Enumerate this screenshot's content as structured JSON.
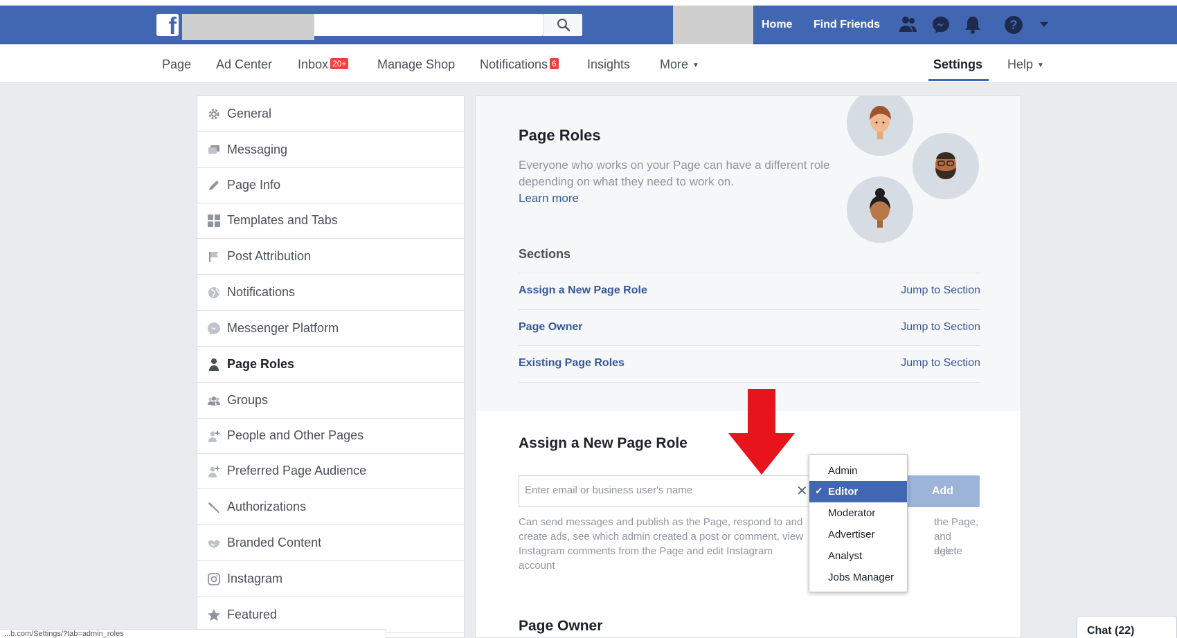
{
  "topbar": {
    "logo": "f",
    "search_placeholder": "",
    "links": {
      "home": "Home",
      "find_friends": "Find Friends"
    },
    "icons": [
      "friend-requests-icon",
      "messenger-icon",
      "notifications-bell-icon",
      "help-icon",
      "account-menu-caret-icon"
    ]
  },
  "page_nav": {
    "items": [
      {
        "label": "Page"
      },
      {
        "label": "Ad Center"
      },
      {
        "label": "Inbox",
        "badge": "20+"
      },
      {
        "label": "Manage Shop"
      },
      {
        "label": "Notifications",
        "badge": "6"
      },
      {
        "label": "Insights"
      },
      {
        "label": "More"
      },
      {
        "label": "Settings",
        "active": true
      },
      {
        "label": "Help"
      }
    ]
  },
  "sidebar": {
    "items": [
      {
        "label": "General",
        "icon": "gear-icon"
      },
      {
        "label": "Messaging",
        "icon": "messaging-icon"
      },
      {
        "label": "Page Info",
        "icon": "pencil-icon"
      },
      {
        "label": "Templates and Tabs",
        "icon": "grid-icon"
      },
      {
        "label": "Post Attribution",
        "icon": "flag-icon"
      },
      {
        "label": "Notifications",
        "icon": "globe-icon"
      },
      {
        "label": "Messenger Platform",
        "icon": "messenger-icon"
      },
      {
        "label": "Page Roles",
        "icon": "person-icon",
        "active": true
      },
      {
        "label": "Groups",
        "icon": "group-icon"
      },
      {
        "label": "People and Other Pages",
        "icon": "person-plus-icon"
      },
      {
        "label": "Preferred Page Audience",
        "icon": "person-plus-icon"
      },
      {
        "label": "Authorizations",
        "icon": "wrench-icon"
      },
      {
        "label": "Branded Content",
        "icon": "handshake-icon"
      },
      {
        "label": "Instagram",
        "icon": "instagram-icon"
      },
      {
        "label": "Featured",
        "icon": "star-icon"
      }
    ]
  },
  "main": {
    "title": "Page Roles",
    "description": "Everyone who works on your Page can have a different role depending on what they need to work on.",
    "learn_more": "Learn more",
    "sections_title": "Sections",
    "sections": [
      {
        "label": "Assign a New Page Role",
        "jump": "Jump to Section"
      },
      {
        "label": "Page Owner",
        "jump": "Jump to Section"
      },
      {
        "label": "Existing Page Roles",
        "jump": "Jump to Section"
      }
    ],
    "assign": {
      "title": "Assign a New Page Role",
      "input_placeholder": "Enter email or business user's name",
      "clear": "✕",
      "add_label": "Add",
      "role_description_visible": "Can send messages and publish as the Page, respond to and create ads, see which admin created a post or comment, view Instagram comments from the Page and edit Instagram account",
      "role_description_right_1": "the Page,",
      "role_description_right_2": "and delete",
      "role_description_right_3": "age."
    },
    "owner_title": "Page Owner"
  },
  "role_dropdown": {
    "options": [
      "Admin",
      "Editor",
      "Moderator",
      "Advertiser",
      "Analyst",
      "Jobs Manager"
    ],
    "selected": "Editor",
    "check": "✓"
  },
  "chat": {
    "label": "Chat (22)"
  },
  "status_bar": {
    "text": "...b.com/Settings/?tab=admin_roles"
  },
  "colors": {
    "brand_blue": "#4267b2",
    "link_blue": "#365899",
    "badge_red": "#fa3e3e",
    "arrow_red": "#e8141c"
  }
}
